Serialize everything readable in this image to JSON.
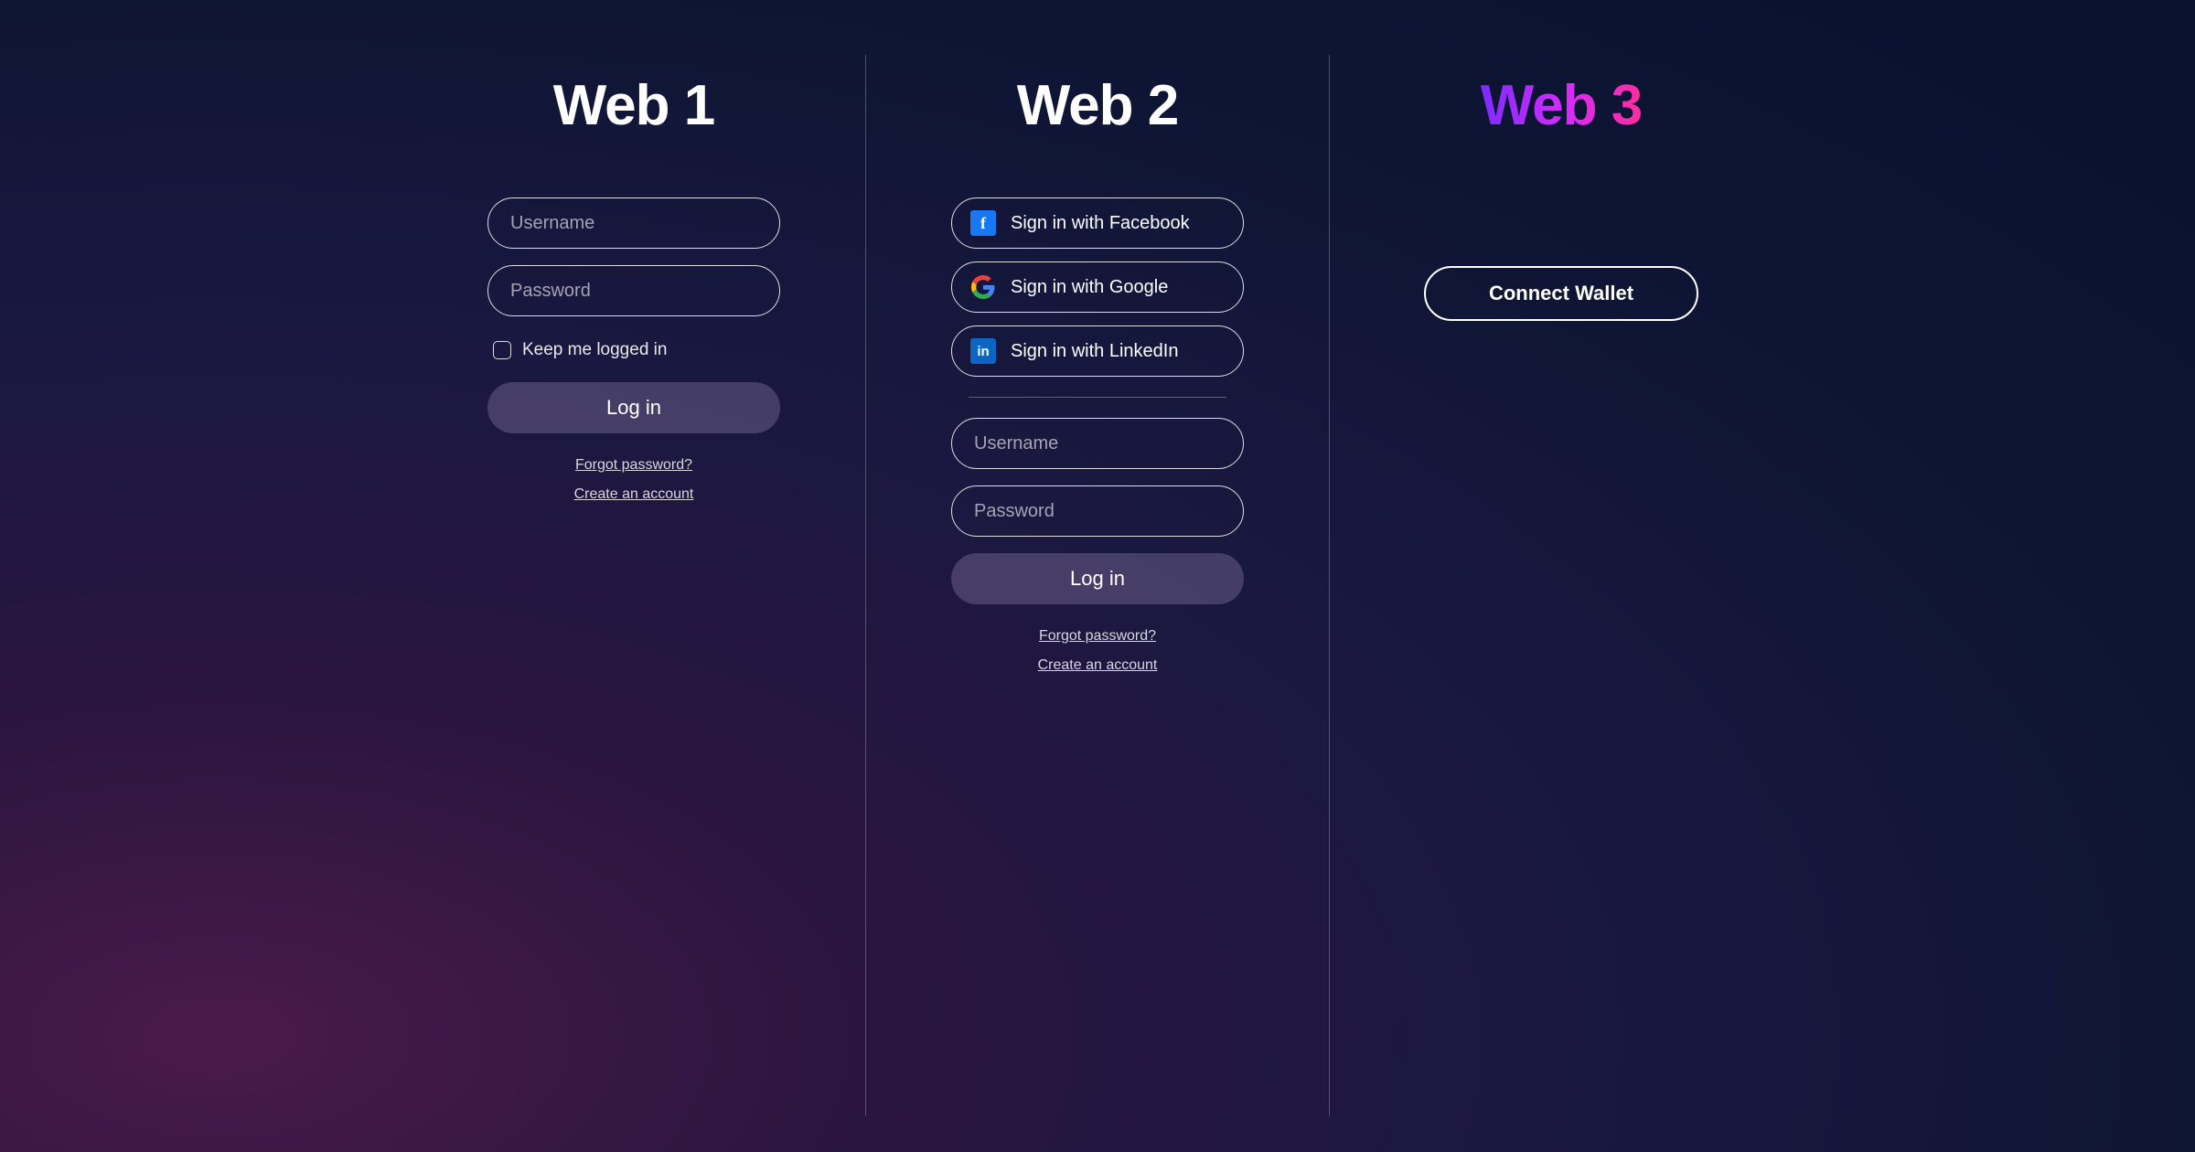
{
  "web1": {
    "title": "Web 1",
    "username_placeholder": "Username",
    "password_placeholder": "Password",
    "keep_logged_label": "Keep me logged in",
    "login_label": "Log in",
    "forgot_label": "Forgot password?",
    "create_label": "Create an account"
  },
  "web2": {
    "title": "Web 2",
    "sso": {
      "facebook": "Sign in with Facebook",
      "google": "Sign in with Google",
      "linkedin": "Sign in with LinkedIn"
    },
    "username_placeholder": "Username",
    "password_placeholder": "Password",
    "login_label": "Log in",
    "forgot_label": "Forgot password?",
    "create_label": "Create an account"
  },
  "web3": {
    "title": "Web 3",
    "connect_label": "Connect Wallet"
  }
}
